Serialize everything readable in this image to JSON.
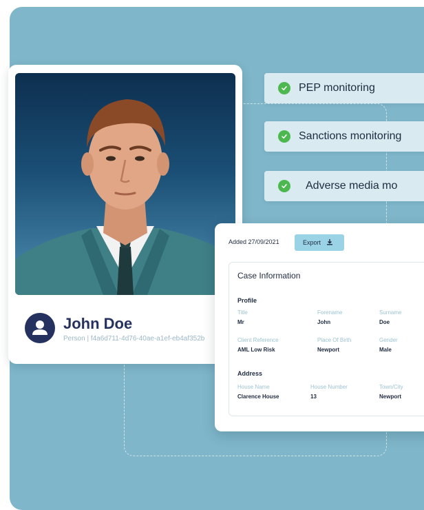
{
  "monitoring": [
    {
      "label": "PEP monitoring",
      "icon": "check-circle-icon"
    },
    {
      "label": "Sanctions monitoring",
      "icon": "check-circle-icon"
    },
    {
      "label": "Adverse media mo",
      "icon": "check-circle-icon"
    }
  ],
  "profile": {
    "name": "John Doe",
    "subtitle": "Person | f4a6d711-4d76-40ae-a1ef-eb4af352b",
    "icon": "person-icon"
  },
  "case": {
    "added": "Added 27/09/2021",
    "export_label": "Export",
    "title": "Case Information",
    "profile_heading": "Profile",
    "address_heading": "Address",
    "fields": {
      "title": {
        "label": "Title",
        "value": "Mr"
      },
      "forename": {
        "label": "Forename",
        "value": "John"
      },
      "surname": {
        "label": "Surname",
        "value": "Doe"
      },
      "client_ref": {
        "label": "Client Reference",
        "value": "AML Low Risk"
      },
      "birth_place": {
        "label": "Place Of Birth",
        "value": "Newport"
      },
      "gender": {
        "label": "Gender",
        "value": "Male"
      },
      "house_name": {
        "label": "House Name",
        "value": "Clarence House"
      },
      "house_number": {
        "label": "House Number",
        "value": "13"
      },
      "town": {
        "label": "Town/City",
        "value": "Newport"
      }
    }
  },
  "colors": {
    "background": "#7fb6c9",
    "navy": "#25325f",
    "check_green": "#4cb84f",
    "pill": "#d9ebf1",
    "export_button": "#9ad3e6"
  }
}
